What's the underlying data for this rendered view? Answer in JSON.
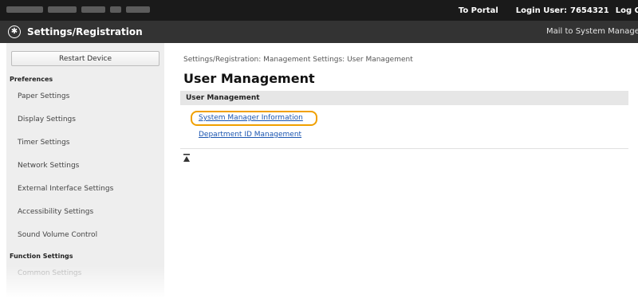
{
  "header": {
    "portal_link": "To Portal",
    "login_label": "Login User:",
    "login_user": "7654321",
    "logout_link": "Log Out"
  },
  "app": {
    "title": "Settings/Registration",
    "mail_link": "Mail to System Manager"
  },
  "sidebar": {
    "restart_button": "Restart Device",
    "preferences_heading": "Preferences",
    "items": [
      {
        "label": "Paper Settings"
      },
      {
        "label": "Display Settings"
      },
      {
        "label": "Timer Settings"
      },
      {
        "label": "Network Settings"
      },
      {
        "label": "External Interface Settings"
      },
      {
        "label": "Accessibility Settings"
      },
      {
        "label": "Sound Volume Control"
      }
    ],
    "function_heading": "Function Settings",
    "function_items": [
      {
        "label": "Common Settings"
      }
    ]
  },
  "main": {
    "breadcrumb": "Settings/Registration: Management Settings: User Management",
    "title": "User Management",
    "section_header": "User Management",
    "links": [
      {
        "label": "System Manager Information"
      },
      {
        "label": "Department ID Management"
      }
    ]
  },
  "colors": {
    "top_bar": "#1a1a1a",
    "app_bar": "#333333",
    "sidebar_bg": "#eeeeee",
    "link": "#1a55b0",
    "highlight": "#f0a000"
  }
}
